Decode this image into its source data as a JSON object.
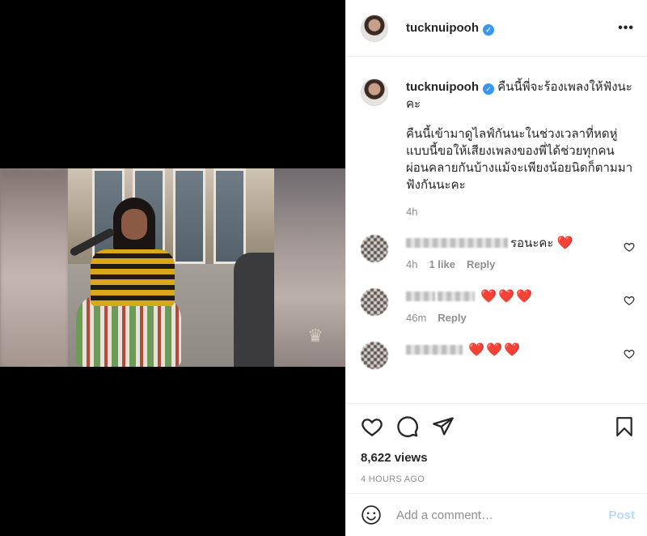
{
  "post": {
    "username": "tucknuipooh",
    "caption_title": "คืนนี้พี่จะร้องเพลงให้ฟังนะคะ",
    "caption_body": "คืนนี้เข้ามาดูไลฟ์กันนะในช่วงเวลาที่หดหู่แบบนี้ขอให้เสียงเพลงของพี่ได้ช่วยทุกคนผ่อนคลายกันบ้างแม้จะเพียงน้อยนิดก็ตามมาฟังกันนะคะ",
    "caption_time": "4h",
    "views": "8,622 views",
    "posted_ago": "4 HOURS AGO"
  },
  "comments": [
    {
      "text": "รอนะคะ",
      "hearts": "❤️",
      "time": "4h",
      "likes": "1 like",
      "reply": "Reply"
    },
    {
      "text": "",
      "hearts": "❤️❤️❤️",
      "time": "46m",
      "likes": "",
      "reply": "Reply"
    },
    {
      "text": "",
      "hearts": "❤️❤️❤️",
      "time": "",
      "likes": "",
      "reply": ""
    }
  ],
  "add_comment": {
    "placeholder": "Add a comment…",
    "post_label": "Post"
  },
  "icons": {
    "verified": "verified-badge-icon",
    "more": "more-options-icon",
    "like": "heart-icon",
    "comment": "comment-icon",
    "share": "share-icon",
    "save": "bookmark-icon",
    "emoji": "emoji-icon"
  },
  "colors": {
    "verified": "#3897f0",
    "heart": "#e0243a",
    "post_disabled": "#b3dbff",
    "muted": "#8e8e8e"
  }
}
